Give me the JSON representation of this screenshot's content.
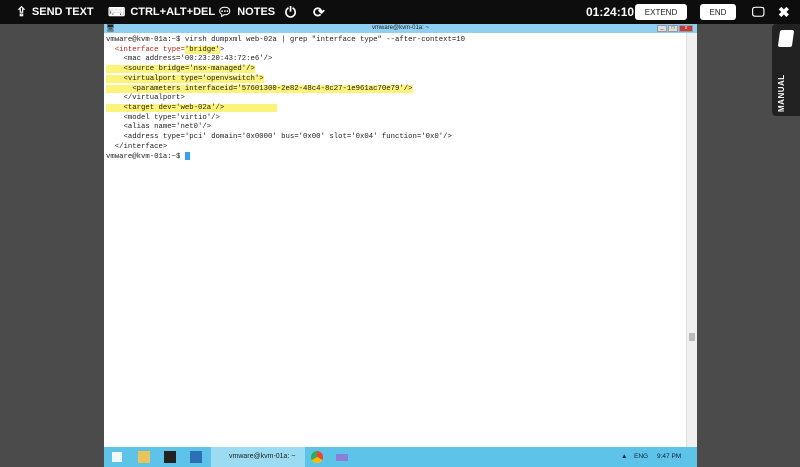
{
  "toolbar": {
    "send_text": "SEND TEXT",
    "ctrl_alt_del": "CTRL+ALT+DEL",
    "notes": "NOTES",
    "timer": "01:24:10",
    "extend": "EXTEND",
    "end": "END"
  },
  "manual": {
    "label": "MANUAL"
  },
  "window": {
    "title": "vmware@kvm-01a: ~"
  },
  "terminal": {
    "lines": [
      "vmware@kvm-01a:~$ virsh dumpxml web-02a | grep \"interface type\" --after-context=10",
      "    <mac address='00:23:20:43:72:e6'/>",
      "    <source bridge='nsx-managed'/>",
      "    <virtualport type='openvswitch'>",
      "      <parameters interfaceid='57601300-2e82-48c4-8c27-1e961ac70e79'/>",
      "    </virtualport>",
      "    <target dev='web-02a'/>",
      "    <model type='virtio'/>",
      "    <alias name='net0'/>",
      "    <address type='pci' domain='0x0000' bus='0x00' slot='0x04' function='0x0'/>",
      "  </interface>",
      "vmware@kvm-01a:~$ "
    ],
    "iface_open": "<interface",
    "iface_type": " type=",
    "iface_val": "'bridge'",
    "iface_close": ">"
  },
  "taskbar": {
    "window_label": "vmware@kvm-01a: ~",
    "lang": "ENG",
    "time": "9:47 PM"
  }
}
